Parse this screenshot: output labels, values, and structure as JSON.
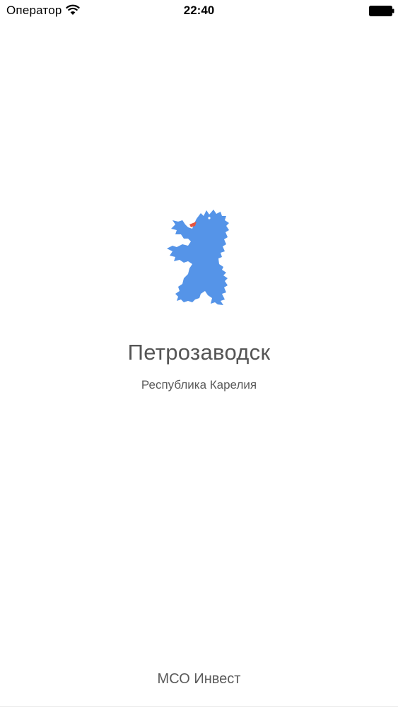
{
  "status_bar": {
    "carrier": "Оператор",
    "time": "22:40",
    "wifi_icon": "wifi-icon",
    "battery_icon": "battery-full-icon"
  },
  "splash": {
    "logo_icon": "karelia-bear-icon",
    "city": "Петрозаводск",
    "region": "Республика Карелия",
    "footer": "МСО Инвест"
  },
  "colors": {
    "logo_blue": "#5594e8",
    "logo_tongue": "#e8553f",
    "text": "#555555",
    "background": "#ffffff"
  }
}
